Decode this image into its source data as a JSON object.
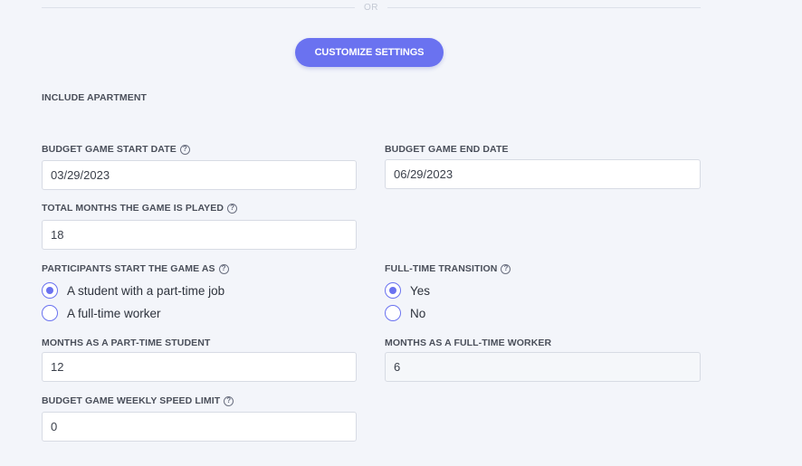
{
  "divider": {
    "text": "OR"
  },
  "customize_button": "CUSTOMIZE SETTINGS",
  "include_apartment_label": "INCLUDE APARTMENT",
  "start_date": {
    "label": "BUDGET GAME START DATE",
    "value": "03/29/2023"
  },
  "end_date": {
    "label": "BUDGET GAME END DATE",
    "value": "06/29/2023"
  },
  "total_months": {
    "label": "TOTAL MONTHS THE GAME IS PLAYED",
    "value": "18"
  },
  "participants": {
    "label": "PARTICIPANTS START THE GAME AS",
    "options": [
      "A student with a part-time job",
      "A full-time worker"
    ],
    "selected": "A student with a part-time job"
  },
  "transition": {
    "label": "FULL-TIME TRANSITION",
    "options": [
      "Yes",
      "No"
    ],
    "selected": "Yes"
  },
  "part_time_months": {
    "label": "MONTHS AS A PART-TIME STUDENT",
    "value": "12"
  },
  "full_time_months": {
    "label": "MONTHS AS A FULL-TIME WORKER",
    "value": "6"
  },
  "speed_limit": {
    "label": "BUDGET GAME WEEKLY SPEED LIMIT",
    "value": "0"
  },
  "colors": {
    "accent": "#6a72f0",
    "background": "#f3f5fa"
  },
  "icons": {
    "help": "question-circle-icon",
    "radio": "radio-icon"
  }
}
